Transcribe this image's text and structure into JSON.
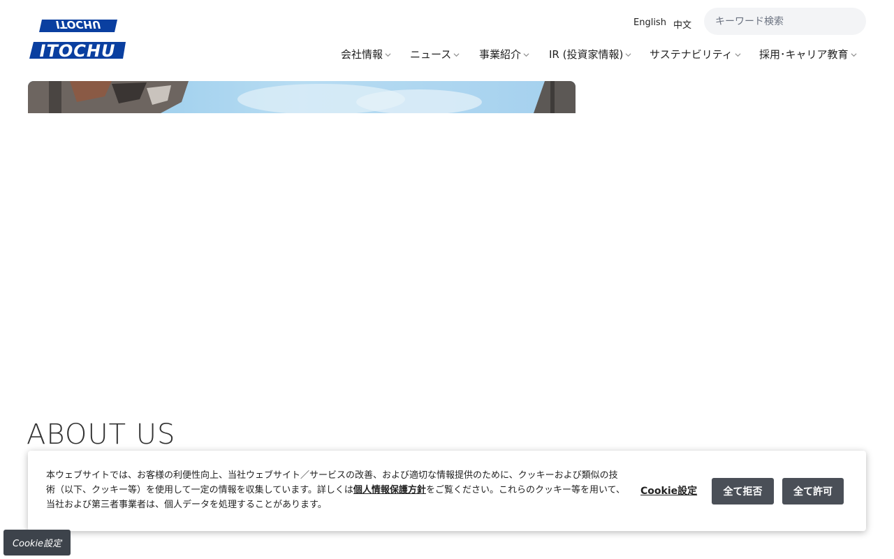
{
  "header": {
    "logo_text": "ITOCHU",
    "languages": [
      "English",
      "中文"
    ],
    "search": {
      "placeholder": "キーワード検索"
    },
    "nav": [
      {
        "label": "会社情報"
      },
      {
        "label": "ニュース"
      },
      {
        "label": "事業紹介"
      },
      {
        "label": "IR (投資家情報)"
      },
      {
        "label": "サステナビリティ"
      },
      {
        "label": "採用･キャリア教育"
      }
    ]
  },
  "main": {
    "about_heading": "ABOUT US"
  },
  "cookie_banner": {
    "text_part1": "本ウェブサイトでは、お客様の利便性向上、当社ウェブサイト／サービスの改善、および適切な情報提供のために、クッキーおよび類似の技術（以下、クッキー等）を使用して一定の情報を収集しています。詳しくは",
    "policy_link": "個人情報保護方針",
    "text_part2": "をご覧ください。これらのクッキー等を用いて、当社および第三者事業者は、個人データを処理することがあります。",
    "settings_link": "Cookie設定",
    "reject_all": "全て拒否",
    "accept_all": "全て許可"
  },
  "floating_cookie_button": "Cookie設定",
  "colors": {
    "brand_blue": "#0a3fa0",
    "button_dark": "#4a4f57",
    "search_bg": "#f3f4f6"
  }
}
